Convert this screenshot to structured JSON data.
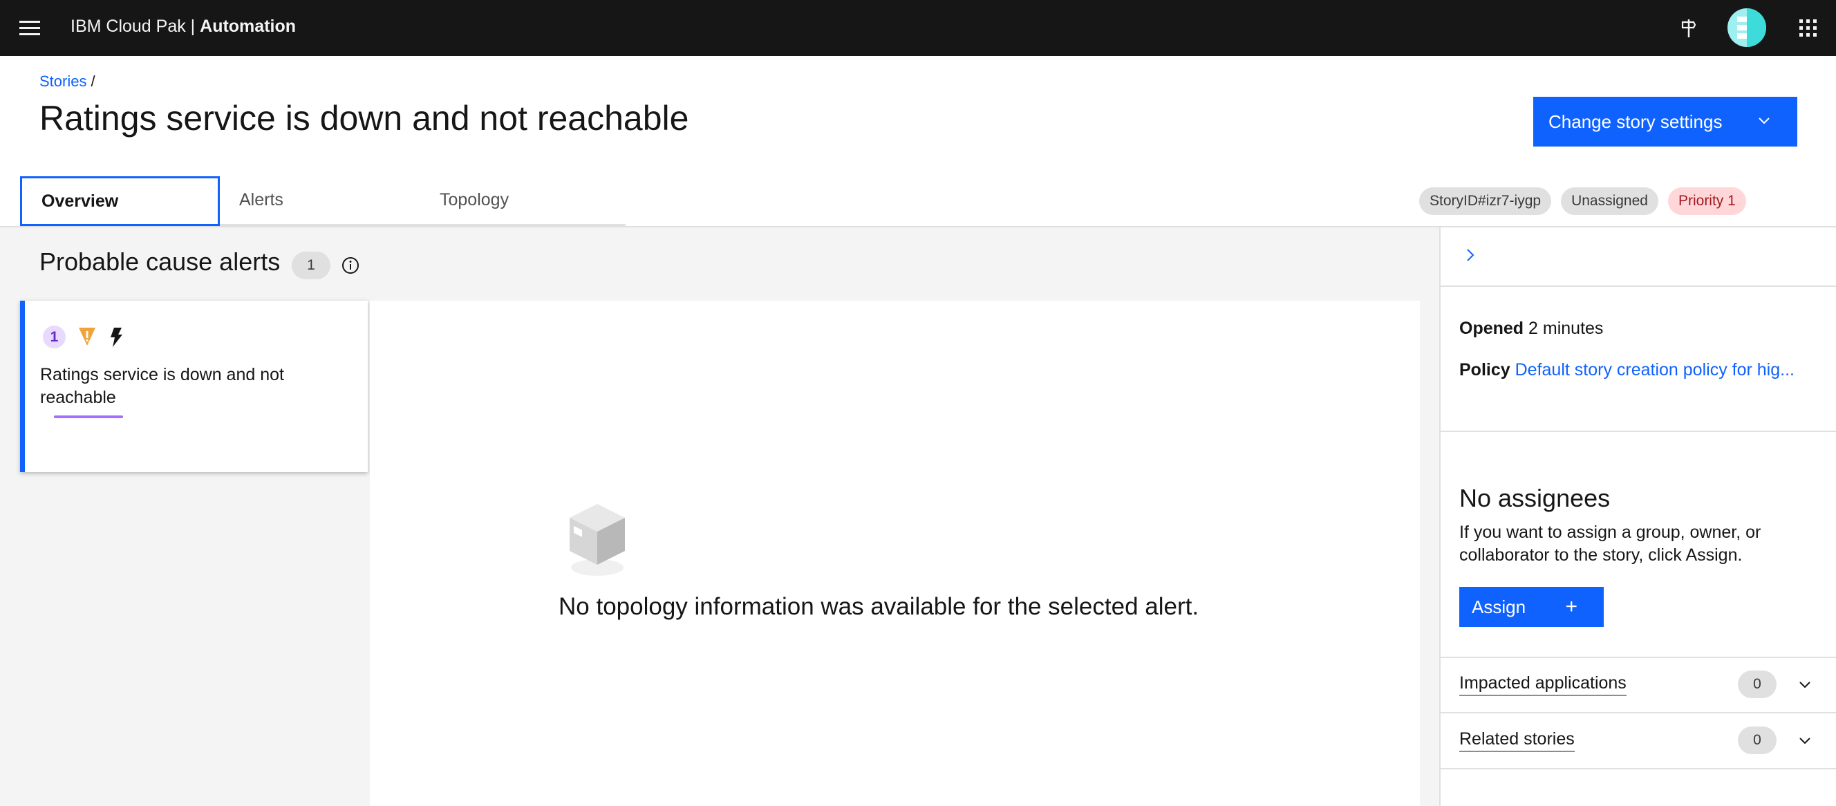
{
  "header": {
    "brand_prefix": "IBM Cloud Pak |",
    "brand_product": "Automation",
    "icons": [
      "menu-icon",
      "signpost-icon",
      "avatar-icon",
      "app-switcher-icon"
    ]
  },
  "breadcrumb": {
    "item": "Stories",
    "separator": "/"
  },
  "page": {
    "title": "Ratings service is down and not reachable",
    "action_label": "Change story settings"
  },
  "tabs": [
    {
      "label": "Overview",
      "active": true
    },
    {
      "label": "Alerts",
      "active": false
    },
    {
      "label": "Topology",
      "active": false
    }
  ],
  "tags": {
    "story_id": "StoryID#izr7-iygp",
    "assignment": "Unassigned",
    "priority": "Priority 1"
  },
  "probable_cause": {
    "title": "Probable cause alerts",
    "count": "1",
    "alert": {
      "rank": "1",
      "text": "Ratings service is down and not reachable"
    }
  },
  "topology": {
    "empty_message": "No topology information was available for the selected alert."
  },
  "details": {
    "opened_label": "Opened",
    "opened_value": "2 minutes",
    "policy_label": "Policy",
    "policy_value": "Default story creation policy for hig..."
  },
  "assignees": {
    "title": "No assignees",
    "description": "If you want to assign a group, owner, or collaborator to the story, click Assign.",
    "button_label": "Assign",
    "button_icon": "+"
  },
  "accordions": [
    {
      "label": "Impacted applications",
      "count": "0"
    },
    {
      "label": "Related stories",
      "count": "0"
    }
  ],
  "colors": {
    "header_bg": "#161616",
    "primary": "#0f62fe",
    "priority_bg": "#ffd7d9",
    "priority_text": "#a2191f",
    "rank_bg": "#e8daff",
    "warning": "#f1a23b",
    "annotation_underline": "#a56eff"
  }
}
